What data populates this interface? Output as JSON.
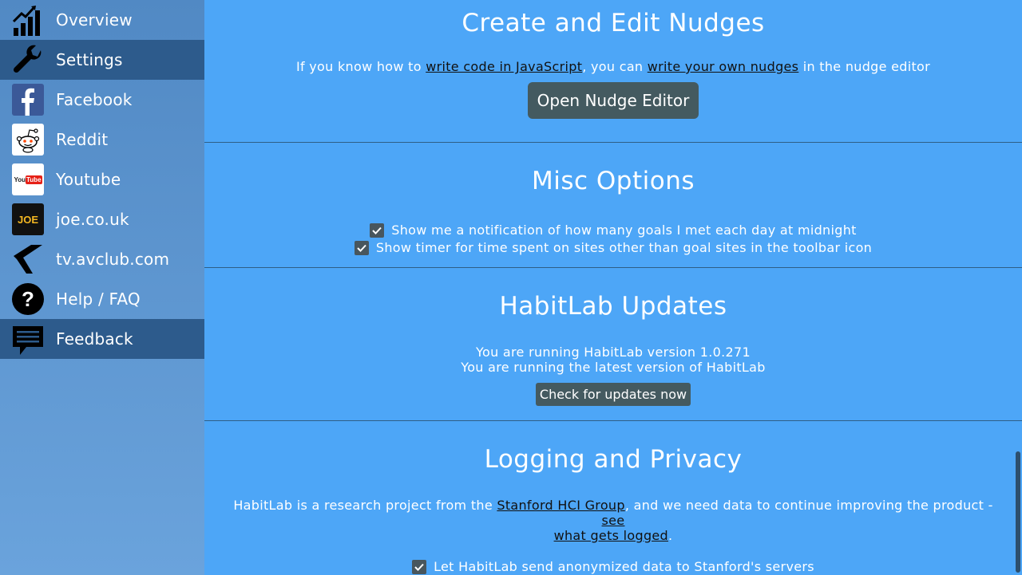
{
  "sidebar": {
    "items": [
      {
        "label": "Overview",
        "icon": "bar-chart-icon",
        "active": false
      },
      {
        "label": "Settings",
        "icon": "wrench-icon",
        "active": true
      },
      {
        "label": "Facebook",
        "icon": "facebook-icon",
        "active": false
      },
      {
        "label": "Reddit",
        "icon": "reddit-icon",
        "active": false
      },
      {
        "label": "Youtube",
        "icon": "youtube-icon",
        "active": false
      },
      {
        "label": "joe.co.uk",
        "icon": "joe-icon",
        "active": false
      },
      {
        "label": "tv.avclub.com",
        "icon": "avclub-icon",
        "active": false
      },
      {
        "label": "Help / FAQ",
        "icon": "help-icon",
        "active": false
      },
      {
        "label": "Feedback",
        "icon": "feedback-icon",
        "active": true
      }
    ],
    "icon_text": {
      "youtube": "YouTube",
      "joe": "JOE",
      "help": "?"
    }
  },
  "nudges": {
    "title": "Create and Edit Nudges",
    "text_1": "If you know how to ",
    "link_1": "write code in JavaScript",
    "text_2": ", you can ",
    "link_2": "write your own nudges",
    "text_3": " in the nudge editor",
    "button": "Open Nudge Editor"
  },
  "misc": {
    "title": "Misc Options",
    "option_1": "Show me a notification of how many goals I met each day at midnight",
    "option_2": "Show timer for time spent on sites other than goal sites in the toolbar icon"
  },
  "updates": {
    "title": "HabitLab Updates",
    "version_line": "You are running HabitLab version 1.0.271",
    "latest_line": "You are running the latest version of HabitLab",
    "button": "Check for updates now"
  },
  "privacy": {
    "title": "Logging and Privacy",
    "text_1": "HabitLab is a research project from the ",
    "link_1": "Stanford HCI Group",
    "text_2": ", and we need data to continue improving the product - ",
    "link_2a": "see",
    "link_2b": "what gets logged",
    "text_3": ".",
    "option": "Let HabitLab send anonymized data to Stanford's servers"
  },
  "colors": {
    "main_bg": "#4da6f7",
    "sidebar_active": "#2d5b8c",
    "button_bg": "#445a60"
  }
}
